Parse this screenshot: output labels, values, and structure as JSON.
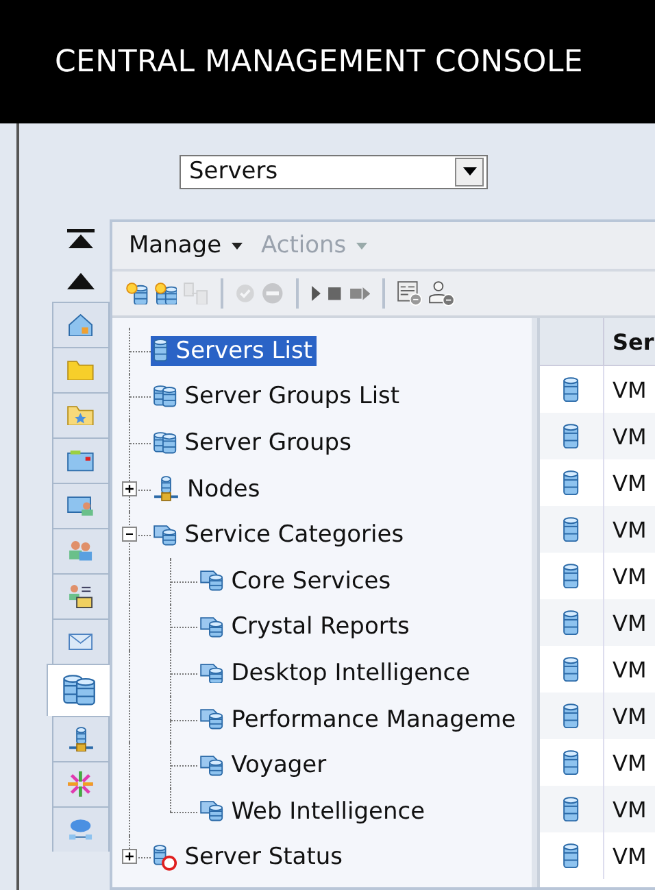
{
  "header": {
    "title": "CENTRAL MANAGEMENT CONSOLE"
  },
  "view_select": {
    "value": "Servers"
  },
  "side_tabs": [
    {
      "kind": "home",
      "selected": false
    },
    {
      "kind": "folder",
      "selected": false
    },
    {
      "kind": "star-folder",
      "selected": false
    },
    {
      "kind": "folder-stack",
      "selected": false
    },
    {
      "kind": "folder-user",
      "selected": false
    },
    {
      "kind": "users",
      "selected": false
    },
    {
      "kind": "user-list",
      "selected": false
    },
    {
      "kind": "mail",
      "selected": false
    },
    {
      "kind": "servers",
      "selected": true
    },
    {
      "kind": "node",
      "selected": false
    },
    {
      "kind": "burst",
      "selected": false
    },
    {
      "kind": "network",
      "selected": false
    }
  ],
  "menu": [
    {
      "label": "Manage",
      "disabled": false
    },
    {
      "label": "Actions",
      "disabled": true
    }
  ],
  "toolbar": [
    {
      "kind": "new-server",
      "disabled": false
    },
    {
      "kind": "new-group",
      "disabled": false
    },
    {
      "kind": "clone",
      "disabled": true
    },
    {
      "kind": "separator"
    },
    {
      "kind": "check",
      "disabled": true
    },
    {
      "kind": "minus",
      "disabled": true
    },
    {
      "kind": "separator"
    },
    {
      "kind": "play",
      "disabled": false
    },
    {
      "kind": "stop",
      "disabled": false
    },
    {
      "kind": "restart",
      "disabled": false
    },
    {
      "kind": "separator"
    },
    {
      "kind": "properties",
      "disabled": false
    },
    {
      "kind": "user",
      "disabled": false
    }
  ],
  "tree": [
    {
      "label": "Servers List",
      "kind": "server",
      "selected": true
    },
    {
      "label": "Server Groups List",
      "kind": "group",
      "selected": false
    },
    {
      "label": "Server Groups",
      "kind": "group",
      "selected": false
    },
    {
      "label": "Nodes",
      "kind": "node",
      "selected": false,
      "expanded": false
    },
    {
      "label": "Service Categories",
      "kind": "category",
      "selected": false,
      "expanded": true,
      "children": [
        {
          "label": "Core Services",
          "kind": "category",
          "selected": false
        },
        {
          "label": "Crystal Reports",
          "kind": "category",
          "selected": false
        },
        {
          "label": "Desktop Intelligence",
          "kind": "category",
          "selected": false
        },
        {
          "label": "Performance Manageme",
          "kind": "category",
          "selected": false
        },
        {
          "label": "Voyager",
          "kind": "category",
          "selected": false
        },
        {
          "label": "Web Intelligence",
          "kind": "category",
          "selected": false
        }
      ]
    },
    {
      "label": "Server Status",
      "kind": "status",
      "selected": false,
      "expanded": false
    }
  ],
  "table": {
    "columns": [
      {
        "label": "Ser"
      }
    ],
    "rows": [
      {
        "cell": "VM"
      },
      {
        "cell": "VM"
      },
      {
        "cell": "VM"
      },
      {
        "cell": "VM"
      },
      {
        "cell": "VM"
      },
      {
        "cell": "VM"
      },
      {
        "cell": "VM"
      },
      {
        "cell": "VM"
      },
      {
        "cell": "VM"
      },
      {
        "cell": "VM"
      },
      {
        "cell": "VM"
      }
    ]
  }
}
